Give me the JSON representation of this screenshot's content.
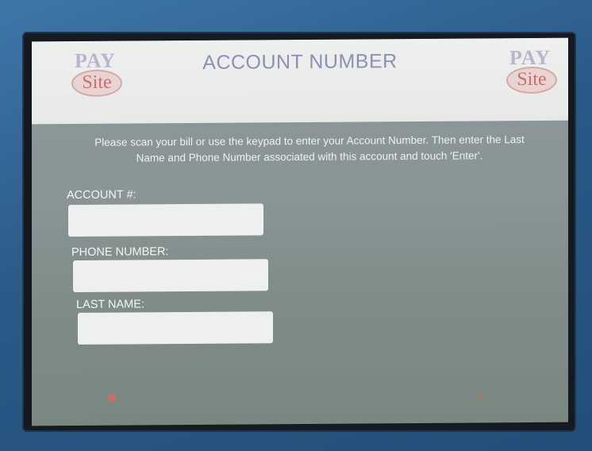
{
  "header": {
    "title": "ACCOUNT NUMBER",
    "logo_left": {
      "top": "PAY",
      "bottom": "Site"
    },
    "logo_right": {
      "top": "PAY",
      "bottom": "Site"
    }
  },
  "instructions": "Please scan your bill or use the keypad to enter your Account Number. Then enter the Last Name and Phone Number associated with this account and touch 'Enter'.",
  "form": {
    "account": {
      "label": "ACCOUNT #:",
      "value": ""
    },
    "phone": {
      "label": "PHONE NUMBER:",
      "value": ""
    },
    "last_name": {
      "label": "LAST NAME:",
      "value": ""
    }
  },
  "footer": {
    "left_button_icon": "red-dot-icon",
    "right_button_icon": "x-icon"
  },
  "colors": {
    "header_bg": "#e7e9e8",
    "title": "#8d8fb3",
    "screen_bg": "#8a9596",
    "kiosk_frame": "#2f5f8f",
    "footer_accent": "#d9695e"
  }
}
